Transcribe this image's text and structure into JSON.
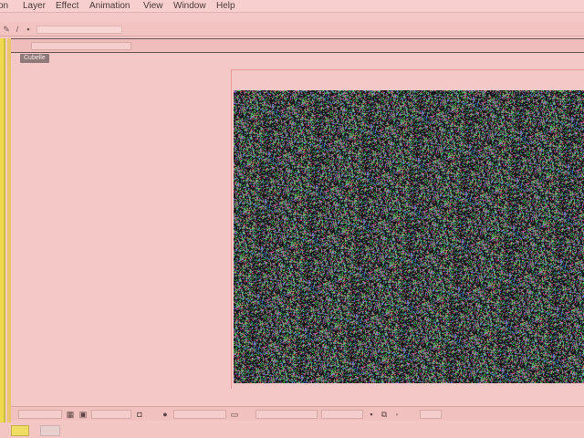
{
  "menubar": {
    "items": [
      "on",
      "Layer",
      "Effect",
      "Animation",
      "View",
      "Window",
      "Help"
    ]
  },
  "window": {
    "title": ""
  },
  "panel": {
    "tab_label": "Cubelle"
  },
  "canvas": {
    "content": "random-color-noise",
    "background_color": "#141414"
  },
  "colors": {
    "app_background": "#f4c8c6",
    "canvas_border": "#e59a98",
    "folder_icon": "#f0dd64"
  },
  "icons": [
    "pen-tool-icon",
    "brush-tool-icon",
    "color-picker-icon",
    "grid-icon",
    "folder-icon"
  ]
}
